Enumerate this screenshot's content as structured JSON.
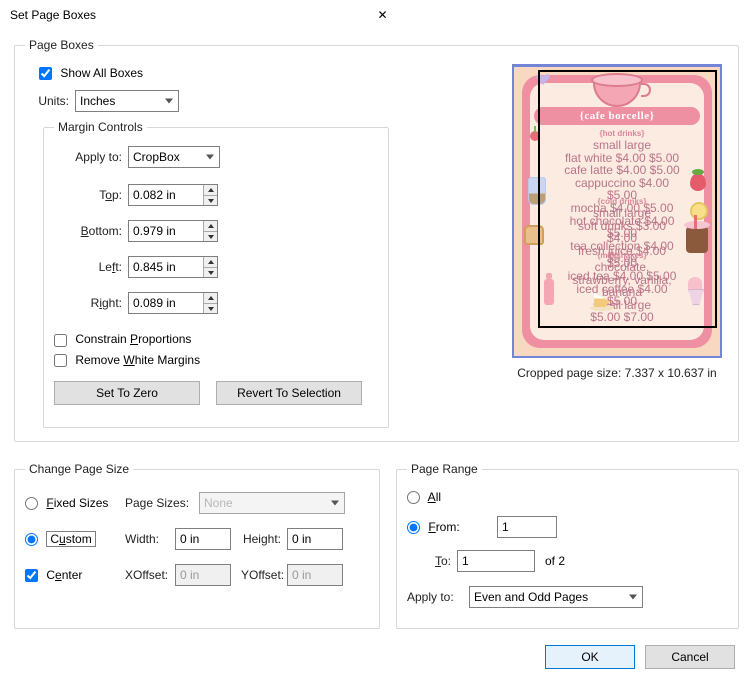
{
  "title": "Set Page Boxes",
  "pageBoxes": {
    "legend": "Page Boxes",
    "showAll": "Show All Boxes",
    "unitsLabel": "Units:",
    "unitsValue": "Inches",
    "marginControlsLegend": "Margin Controls",
    "applyToLabel": "Apply to:",
    "applyToValue": "CropBox",
    "topLabel": "Top:",
    "topValue": "0.082 in",
    "bottomLabel": "Bottom:",
    "bottomValue": "0.979 in",
    "leftLabel": "Left:",
    "leftValue": "0.845 in",
    "rightLabel": "Right:",
    "rightValue": "0.089 in",
    "constrain": "Constrain Proportions",
    "removeWhite": "Remove White Margins",
    "setZero": "Set To Zero",
    "revert": "Revert To Selection",
    "caption": "Cropped page size: 7.337 x 10.637 in"
  },
  "changeSize": {
    "legend": "Change Page Size",
    "fixed": "Fixed Sizes",
    "pageSizesLabel": "Page Sizes:",
    "pageSizesValue": "None",
    "custom": "Custom",
    "widthLabel": "Width:",
    "widthValue": "0 in",
    "heightLabel": "Height:",
    "heightValue": "0 in",
    "center": "Center",
    "xoffLabel": "XOffset:",
    "xoffValue": "0 in",
    "yoffLabel": "YOffset:",
    "yoffValue": "0 in"
  },
  "pageRange": {
    "legend": "Page Range",
    "all": "All",
    "from": "From:",
    "fromValue": "1",
    "to": "To:",
    "toValue": "1",
    "ofTotal": "of 2",
    "applyToLabel": "Apply to:",
    "applyToValue": "Even and Odd Pages"
  },
  "buttons": {
    "ok": "OK",
    "cancel": "Cancel"
  },
  "preview": {
    "title": "{cafe borcelle}",
    "hotHead": "{hot drinks}",
    "hotBody": "small     large\nflat white  $4.00  $5.00\ncafe latte  $4.00  $5.00\ncappuccino  $4.00  $5.00\nmocha  $4.00  $5.00\nhot chocolate  $4.00  $5.00\ntea collection  $4.00  $5.00",
    "coldHead": "{cold drinks}",
    "coldBody": "small     large\nsoft drinks  $3.00  $4.00\nfresh juice  $4.00  $5.00\niced tea  $4.00  $5.00\niced coffee  $4.00  $5.00",
    "milkHead": "{milkshakes}",
    "milkBody": "chocolate, strawberry, vanilla, banana\nsmall     large\n$5.00    $7.00"
  }
}
